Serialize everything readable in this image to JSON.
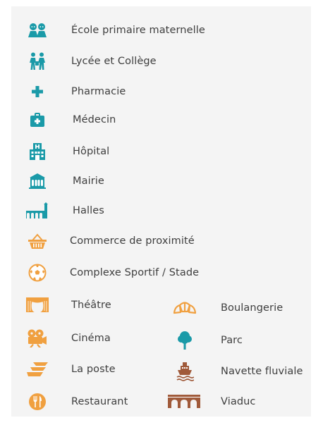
{
  "legend": {
    "colors": {
      "teal": "#1a9aa8",
      "orange": "#f0a040",
      "brown": "#a05a3a",
      "dark": "#3e3e3e",
      "panel": "#f4f4f4"
    },
    "items": [
      {
        "icon": "children-icon",
        "label": "École primaire maternelle"
      },
      {
        "icon": "students-icon",
        "label": "Lycée et Collège"
      },
      {
        "icon": "pharmacy-cross-icon",
        "label": "Pharmacie"
      },
      {
        "icon": "medical-kit-icon",
        "label": "Médecin"
      },
      {
        "icon": "hospital-icon",
        "label": "Hôpital"
      },
      {
        "icon": "town-hall-icon",
        "label": "Mairie"
      },
      {
        "icon": "market-hall-icon",
        "label": "Halles"
      },
      {
        "icon": "basket-icon",
        "label": "Commerce de proximité"
      },
      {
        "icon": "soccer-ball-icon",
        "label": "Complexe Sportif / Stade"
      },
      {
        "icon": "theatre-curtain-icon",
        "label": "Théâtre"
      },
      {
        "icon": "film-camera-icon",
        "label": "Cinéma"
      },
      {
        "icon": "post-office-icon",
        "label": "La poste"
      },
      {
        "icon": "restaurant-icon",
        "label": "Restaurant"
      },
      {
        "icon": "croissant-icon",
        "label": "Boulangerie"
      },
      {
        "icon": "tree-icon",
        "label": "Parc"
      },
      {
        "icon": "river-shuttle-icon",
        "label": "Navette fluviale"
      },
      {
        "icon": "viaduct-icon",
        "label": "Viaduc"
      }
    ]
  }
}
